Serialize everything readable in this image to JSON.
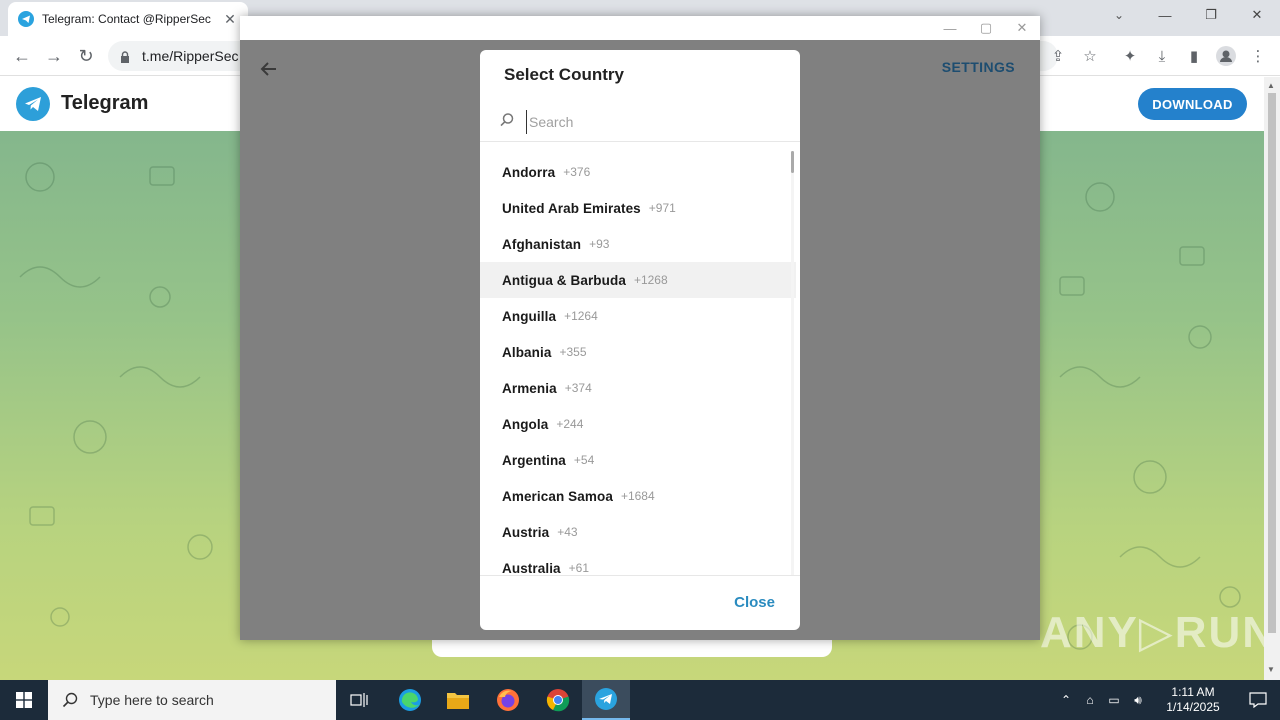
{
  "browser": {
    "tab_title": "Telegram: Contact @RipperSec",
    "tab_close": "✕",
    "url": "t.me/RipperSec"
  },
  "telegram": {
    "brand": "Telegram",
    "download_label": "DOWNLOAD",
    "watermark": "ANY▷RUN"
  },
  "popup": {
    "settings_label": "SETTINGS"
  },
  "modal": {
    "title": "Select Country",
    "search_placeholder": "Search",
    "close_label": "Close",
    "countries": [
      {
        "name": "Andorra",
        "code": "+376"
      },
      {
        "name": "United Arab Emirates",
        "code": "+971"
      },
      {
        "name": "Afghanistan",
        "code": "+93"
      },
      {
        "name": "Antigua & Barbuda",
        "code": "+1268"
      },
      {
        "name": "Anguilla",
        "code": "+1264"
      },
      {
        "name": "Albania",
        "code": "+355"
      },
      {
        "name": "Armenia",
        "code": "+374"
      },
      {
        "name": "Angola",
        "code": "+244"
      },
      {
        "name": "Argentina",
        "code": "+54"
      },
      {
        "name": "American Samoa",
        "code": "+1684"
      },
      {
        "name": "Austria",
        "code": "+43"
      },
      {
        "name": "Australia",
        "code": "+61"
      }
    ],
    "hovered_index": 3
  },
  "taskbar": {
    "search_text": "Type here to search",
    "time": "1:11 AM",
    "date": "1/14/2025"
  },
  "colors": {
    "telegram_blue": "#2481cc",
    "accent_link": "#2a8bbf"
  }
}
